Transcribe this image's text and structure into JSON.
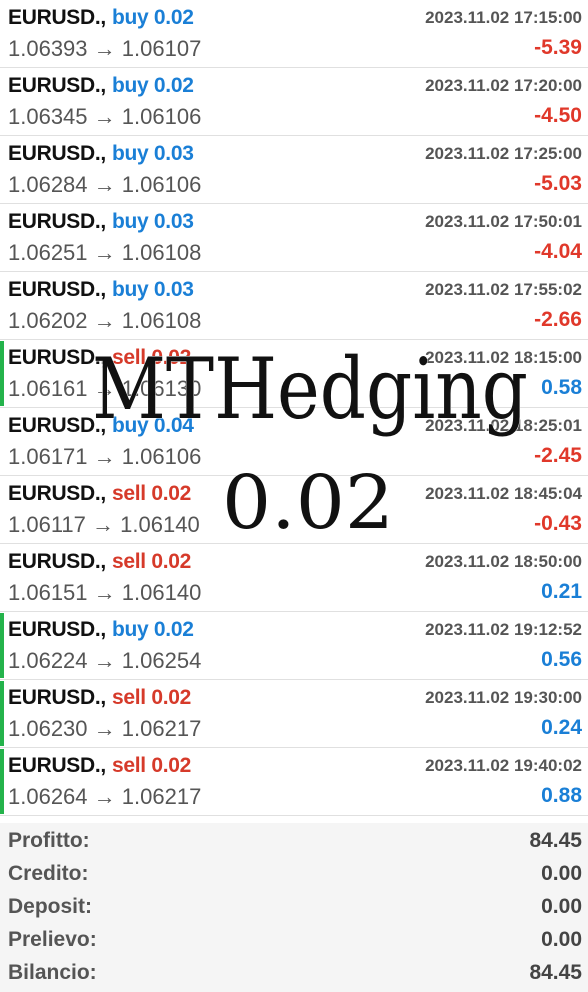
{
  "trades": [
    {
      "symbol": "EURUSD.,",
      "side": "buy",
      "volume": "buy 0.02",
      "time": "2023.11.02 17:15:00",
      "open": "1.06393",
      "arrow": "→",
      "close": "1.06107",
      "profit": "-5.39",
      "win": false
    },
    {
      "symbol": "EURUSD.,",
      "side": "buy",
      "volume": "buy 0.02",
      "time": "2023.11.02 17:20:00",
      "open": "1.06345",
      "arrow": "→",
      "close": "1.06106",
      "profit": "-4.50",
      "win": false
    },
    {
      "symbol": "EURUSD.,",
      "side": "buy",
      "volume": "buy 0.03",
      "time": "2023.11.02 17:25:00",
      "open": "1.06284",
      "arrow": "→",
      "close": "1.06106",
      "profit": "-5.03",
      "win": false
    },
    {
      "symbol": "EURUSD.,",
      "side": "buy",
      "volume": "buy 0.03",
      "time": "2023.11.02 17:50:01",
      "open": "1.06251",
      "arrow": "→",
      "close": "1.06108",
      "profit": "-4.04",
      "win": false
    },
    {
      "symbol": "EURUSD.,",
      "side": "buy",
      "volume": "buy 0.03",
      "time": "2023.11.02 17:55:02",
      "open": "1.06202",
      "arrow": "→",
      "close": "1.06108",
      "profit": "-2.66",
      "win": false
    },
    {
      "symbol": "EURUSD.,",
      "side": "sell",
      "volume": "sell 0.02",
      "time": "2023.11.02 18:15:00",
      "open": "1.06161",
      "arrow": "→",
      "close": "1.06130",
      "profit": "0.58",
      "win": true
    },
    {
      "symbol": "EURUSD.,",
      "side": "buy",
      "volume": "buy 0.04",
      "time": "2023.11.02 18:25:01",
      "open": "1.06171",
      "arrow": "→",
      "close": "1.06106",
      "profit": "-2.45",
      "win": false
    },
    {
      "symbol": "EURUSD.,",
      "side": "sell",
      "volume": "sell 0.02",
      "time": "2023.11.02 18:45:04",
      "open": "1.06117",
      "arrow": "→",
      "close": "1.06140",
      "profit": "-0.43",
      "win": false
    },
    {
      "symbol": "EURUSD.,",
      "side": "sell",
      "volume": "sell 0.02",
      "time": "2023.11.02 18:50:00",
      "open": "1.06151",
      "arrow": "→",
      "close": "1.06140",
      "profit": "0.21",
      "win": false
    },
    {
      "symbol": "EURUSD.,",
      "side": "buy",
      "volume": "buy 0.02",
      "time": "2023.11.02 19:12:52",
      "open": "1.06224",
      "arrow": "→",
      "close": "1.06254",
      "profit": "0.56",
      "win": true
    },
    {
      "symbol": "EURUSD.,",
      "side": "sell",
      "volume": "sell 0.02",
      "time": "2023.11.02 19:30:00",
      "open": "1.06230",
      "arrow": "→",
      "close": "1.06217",
      "profit": "0.24",
      "win": true
    },
    {
      "symbol": "EURUSD.,",
      "side": "sell",
      "volume": "sell 0.02",
      "time": "2023.11.02 19:40:02",
      "open": "1.06264",
      "arrow": "→",
      "close": "1.06217",
      "profit": "0.88",
      "win": true
    }
  ],
  "summary": [
    {
      "label": "Profitto:",
      "value": "84.45"
    },
    {
      "label": "Credito:",
      "value": "0.00"
    },
    {
      "label": "Deposit:",
      "value": "0.00"
    },
    {
      "label": "Prelievo:",
      "value": "0.00"
    },
    {
      "label": "Bilancio:",
      "value": "84.45"
    }
  ],
  "watermark": {
    "title": "MTHedging",
    "subtitle": "0.02"
  },
  "colors": {
    "buy": "#1a7fd6",
    "sell": "#d63a2a",
    "loss": "#e0382a",
    "gain": "#1a7fd6",
    "win_marker": "#24b34b"
  }
}
